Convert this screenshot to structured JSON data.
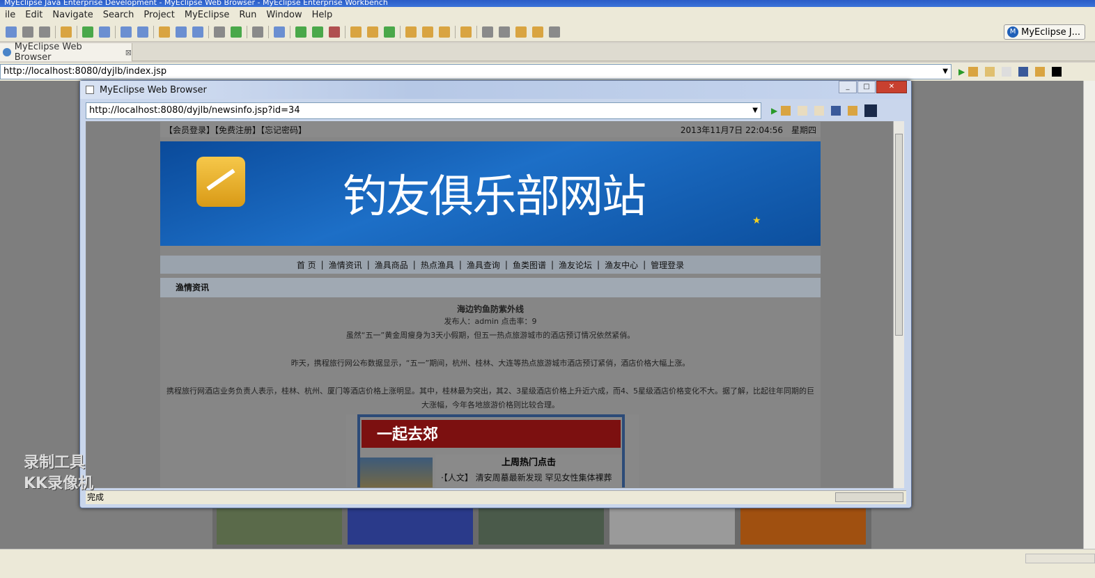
{
  "window": {
    "title": "MyEclipse Java Enterprise Development - MyEclipse Web Browser - MyEclipse Enterprise Workbench"
  },
  "menu": [
    "ile",
    "Edit",
    "Navigate",
    "Search",
    "Project",
    "MyEclipse",
    "Run",
    "Window",
    "Help"
  ],
  "perspective": {
    "label": "MyEclipse J..."
  },
  "view_tab": {
    "label": "MyEclipse Web Browser",
    "close": "⊠"
  },
  "outer_url": "http://localhost:8080/dyjlb/index.jsp",
  "dialog": {
    "title": "MyEclipse Web Browser",
    "url": "http://localhost:8080/dyjlb/newsinfo.jsp?id=34",
    "status": "完成"
  },
  "site": {
    "toplinks": "【会员登录】【免费注册】【忘记密码】",
    "datetime": "2013年11月7日 22:04:56　星期四",
    "banner_title": "钓友俱乐部网站",
    "nav": [
      "首 页",
      "渔情资讯",
      "渔具商品",
      "热点渔具",
      "渔具查询",
      "鱼类图谱",
      "渔友论坛",
      "渔友中心",
      "管理登录"
    ],
    "section": "渔情资讯",
    "article": {
      "title": "海边钓鱼防紫外线",
      "meta": "发布人：admin 点击率：9",
      "p1": "虽然“五一”黄金周瘦身为3天小假期，但五一热点旅游城市的酒店预订情况依然紧俏。",
      "p2": "昨天，携程旅行网公布数据显示，“五一”期间，杭州、桂林、大连等热点旅游城市酒店预订紧俏，酒店价格大幅上涨。",
      "p3": "携程旅行网酒店业务负责人表示，桂林、杭州、厦门等酒店价格上涨明显。其中，桂林最为突出，其2、3星级酒店价格上升近六成，而4、5星级酒店价格变化不大。据了解，比起往年同期的巨大涨幅，今年各地旅游价格则比较合理。"
    },
    "ad": {
      "banner": "一起去郊",
      "hot_title": "上周热门点击",
      "hot_item": "·【人文】 清安周墓最新发现 罕见女性集体裸葬"
    }
  },
  "watermark": {
    "line1": "录制工具",
    "line2": "KK录像机"
  }
}
